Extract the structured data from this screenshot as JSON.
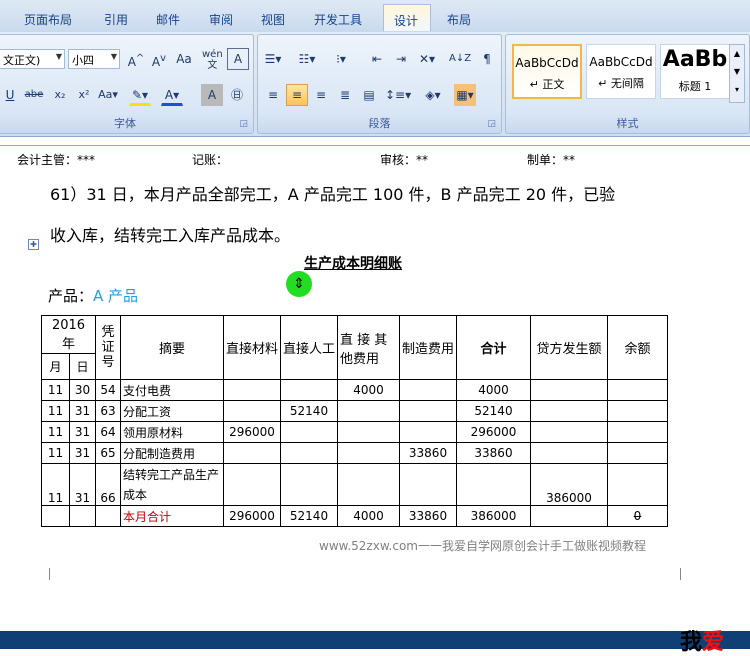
{
  "ribbon_tabs": [
    "页面布局",
    "引用",
    "邮件",
    "审阅",
    "视图",
    "开发工具",
    "设计",
    "布局"
  ],
  "font": {
    "name": "文正文)",
    "size": "小四",
    "group_label": "字体"
  },
  "paragraph": {
    "group_label": "段落"
  },
  "styles": {
    "group_label": "样式",
    "items": [
      {
        "preview": "AaBbCcDd",
        "name": "↵ 正文"
      },
      {
        "preview": "AaBbCcDd",
        "name": "↵ 无间隔"
      },
      {
        "preview": "AaBb",
        "name": "标题 1"
      }
    ]
  },
  "doc": {
    "header": {
      "supervisor": "会计主管：***",
      "bookkeeper": "记账：",
      "reviewer": "审核：**",
      "preparer": "制单：**"
    },
    "paragraph_line1": "61）31 日，本月产品全部完工，A 产品完工 100 件，B 产品完工 20 件，已验",
    "paragraph_line2": "收入库，结转完工入库产品成本。",
    "table_title": "生产成本明细账",
    "product_label": "产品：",
    "product_value": "A 产品",
    "footer": "www.52zxw.com一一我爱自学网原创会计手工做账视频教程"
  },
  "ledger": {
    "year_header": "2016 年",
    "month_header": "月",
    "day_header": "日",
    "voucher_header": "凭证号",
    "headers": [
      "摘要",
      "直接材料",
      "直接人工",
      "直 接 其他费用",
      "制造费用",
      "合计",
      "贷方发生额",
      "余额"
    ],
    "rows": [
      {
        "m": "11",
        "d": "30",
        "v": "54",
        "desc": "支付电费",
        "mat": "",
        "lab": "",
        "oth": "4000",
        "ovh": "",
        "tot": "4000",
        "cr": "",
        "bal": ""
      },
      {
        "m": "11",
        "d": "31",
        "v": "63",
        "desc": "分配工资",
        "mat": "",
        "lab": "52140",
        "oth": "",
        "ovh": "",
        "tot": "52140",
        "cr": "",
        "bal": ""
      },
      {
        "m": "11",
        "d": "31",
        "v": "64",
        "desc": "领用原材料",
        "mat": "296000",
        "lab": "",
        "oth": "",
        "ovh": "",
        "tot": "296000",
        "cr": "",
        "bal": ""
      },
      {
        "m": "11",
        "d": "31",
        "v": "65",
        "desc": "分配制造费用",
        "mat": "",
        "lab": "",
        "oth": "",
        "ovh": "33860",
        "tot": "33860",
        "cr": "",
        "bal": ""
      },
      {
        "m": "11",
        "d": "31",
        "v": "66",
        "desc": "结转完工产品生产成本",
        "mat": "",
        "lab": "",
        "oth": "",
        "ovh": "",
        "tot": "",
        "cr": "386000",
        "bal": ""
      }
    ],
    "total": {
      "desc": "本月合计",
      "mat": "296000",
      "lab": "52140",
      "oth": "4000",
      "ovh": "33860",
      "tot": "386000",
      "cr": "",
      "bal": "0"
    }
  },
  "watermark": {
    "a": "我",
    "b": "爱"
  },
  "colors": {
    "accent": "#1ea0e0",
    "red": "#c00000",
    "selected_style": "#f2b64a"
  }
}
